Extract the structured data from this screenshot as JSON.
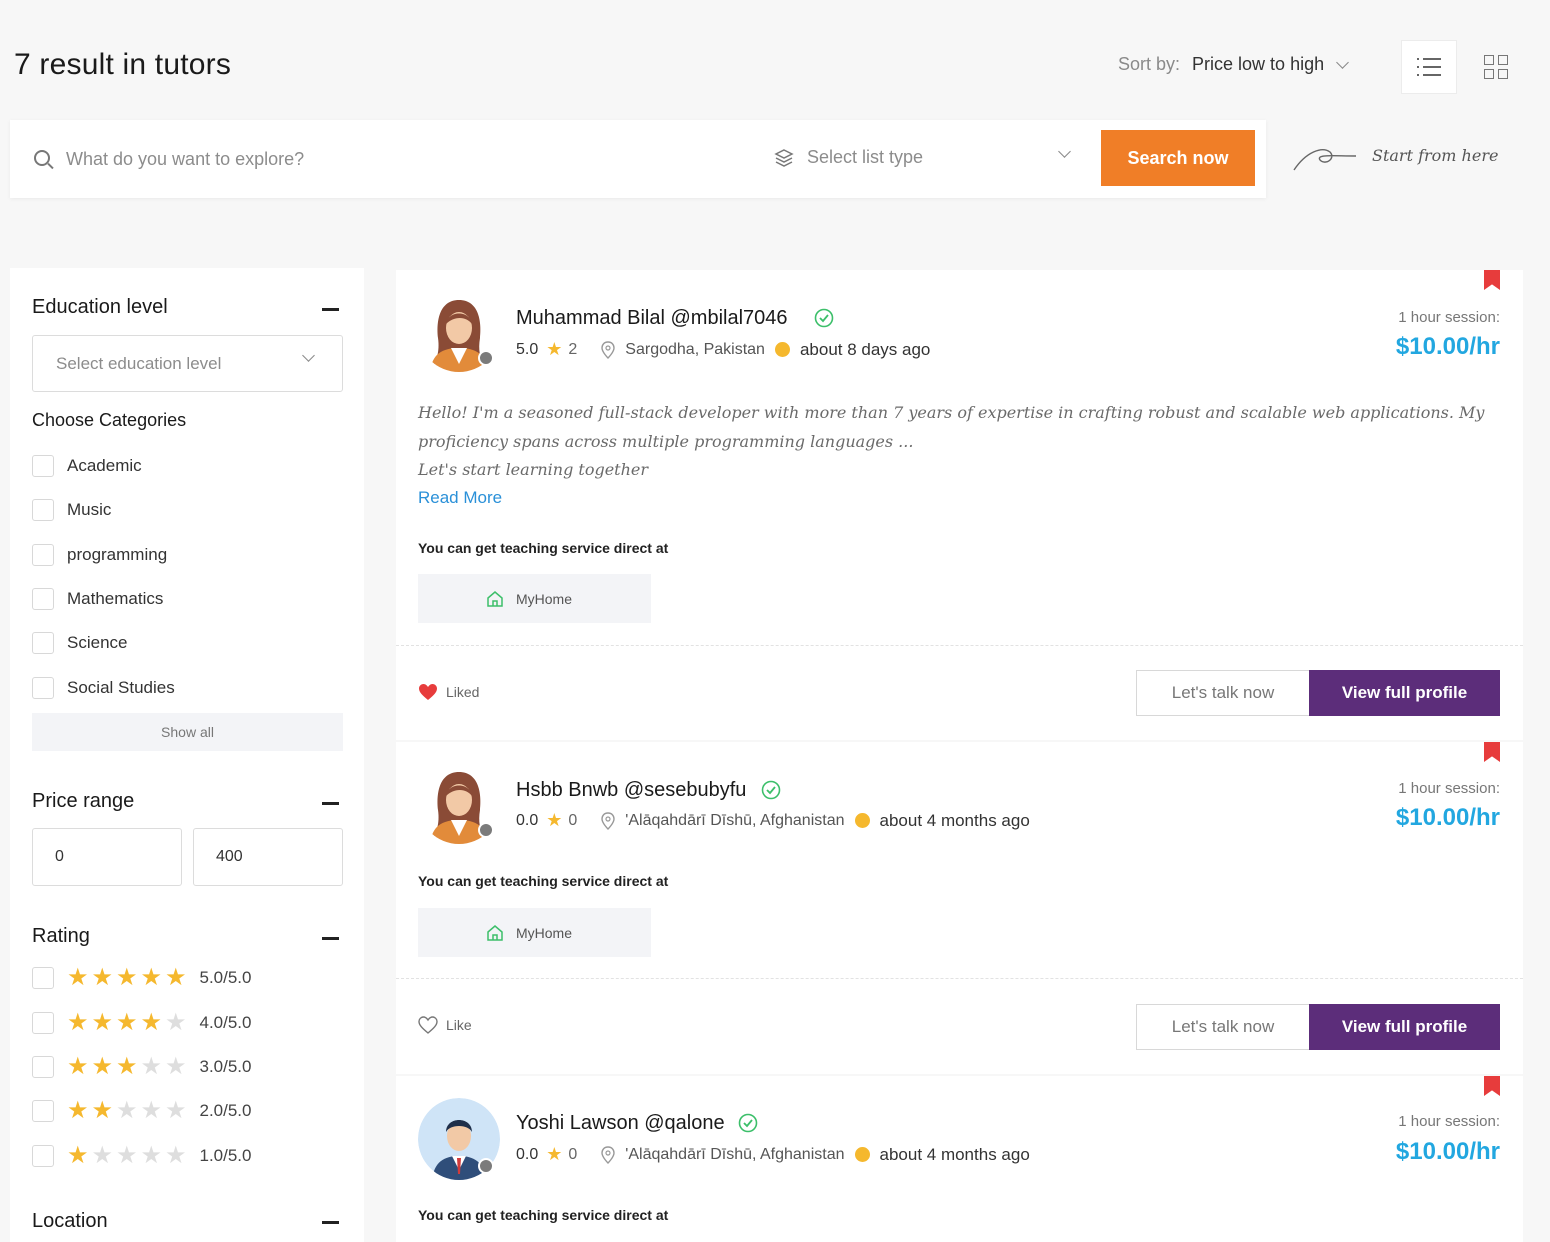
{
  "header": {
    "title": "7 result in  tutors",
    "sort_label": "Sort by:",
    "sort_value": "Price low to high"
  },
  "search": {
    "placeholder": "What do you want to explore?",
    "list_type_placeholder": "Select list type",
    "button_label": "Search now",
    "hint": "Start from here"
  },
  "sidebar": {
    "education_title": "Education level",
    "education_placeholder": "Select education level",
    "categories_title": "Choose Categories",
    "categories": [
      "Academic",
      "Music",
      "programming",
      "Mathematics",
      "Science",
      "Social Studies"
    ],
    "show_all": "Show all",
    "price_title": "Price range",
    "price_min": "0",
    "price_max": "400",
    "rating_title": "Rating",
    "ratings": [
      {
        "label": "5.0/5.0",
        "stars": 5
      },
      {
        "label": "4.0/5.0",
        "stars": 4
      },
      {
        "label": "3.0/5.0",
        "stars": 3
      },
      {
        "label": "2.0/5.0",
        "stars": 2
      },
      {
        "label": "1.0/5.0",
        "stars": 1
      }
    ],
    "location_title": "Location"
  },
  "tutors": [
    {
      "name": "Muhammad Bilal @mbilal7046",
      "rating": "5.0",
      "reviews": "2",
      "location": "Sargodha, Pakistan",
      "time": "about 8 days ago",
      "session_label": "1 hour session:",
      "price": "$10.00/hr",
      "bio": "Hello! I'm a seasoned full-stack developer with more than 7 years of expertise in crafting robust and scalable web applications. My proficiency spans across multiple programming languages ...",
      "bio_tagline": "Let's start learning together",
      "read_more": "Read More",
      "service_label": "You can get teaching service direct at",
      "service_place": "MyHome",
      "like_label": "Liked",
      "talk_label": "Let's talk now",
      "profile_label": "View full profile"
    },
    {
      "name": "Hsbb Bnwb @sesebubyfu",
      "rating": "0.0",
      "reviews": "0",
      "location": "'Alāqahdārī Dīshū, Afghanistan",
      "time": "about 4 months ago",
      "session_label": "1 hour session:",
      "price": "$10.00/hr",
      "service_label": "You can get teaching service direct at",
      "service_place": "MyHome",
      "like_label": "Like",
      "talk_label": "Let's talk now",
      "profile_label": "View full profile"
    },
    {
      "name": "Yoshi Lawson @qalone",
      "rating": "0.0",
      "reviews": "0",
      "location": "'Alāqahdārī Dīshū, Afghanistan",
      "time": "about 4 months ago",
      "session_label": "1 hour session:",
      "price": "$10.00/hr",
      "service_label": "You can get teaching service direct at"
    }
  ],
  "colors": {
    "accent_orange": "#f07e27",
    "primary_purple": "#5c2d7a",
    "price_blue": "#22a7e0",
    "star_yellow": "#f5b82e",
    "bookmark_red": "#e73c3c"
  }
}
